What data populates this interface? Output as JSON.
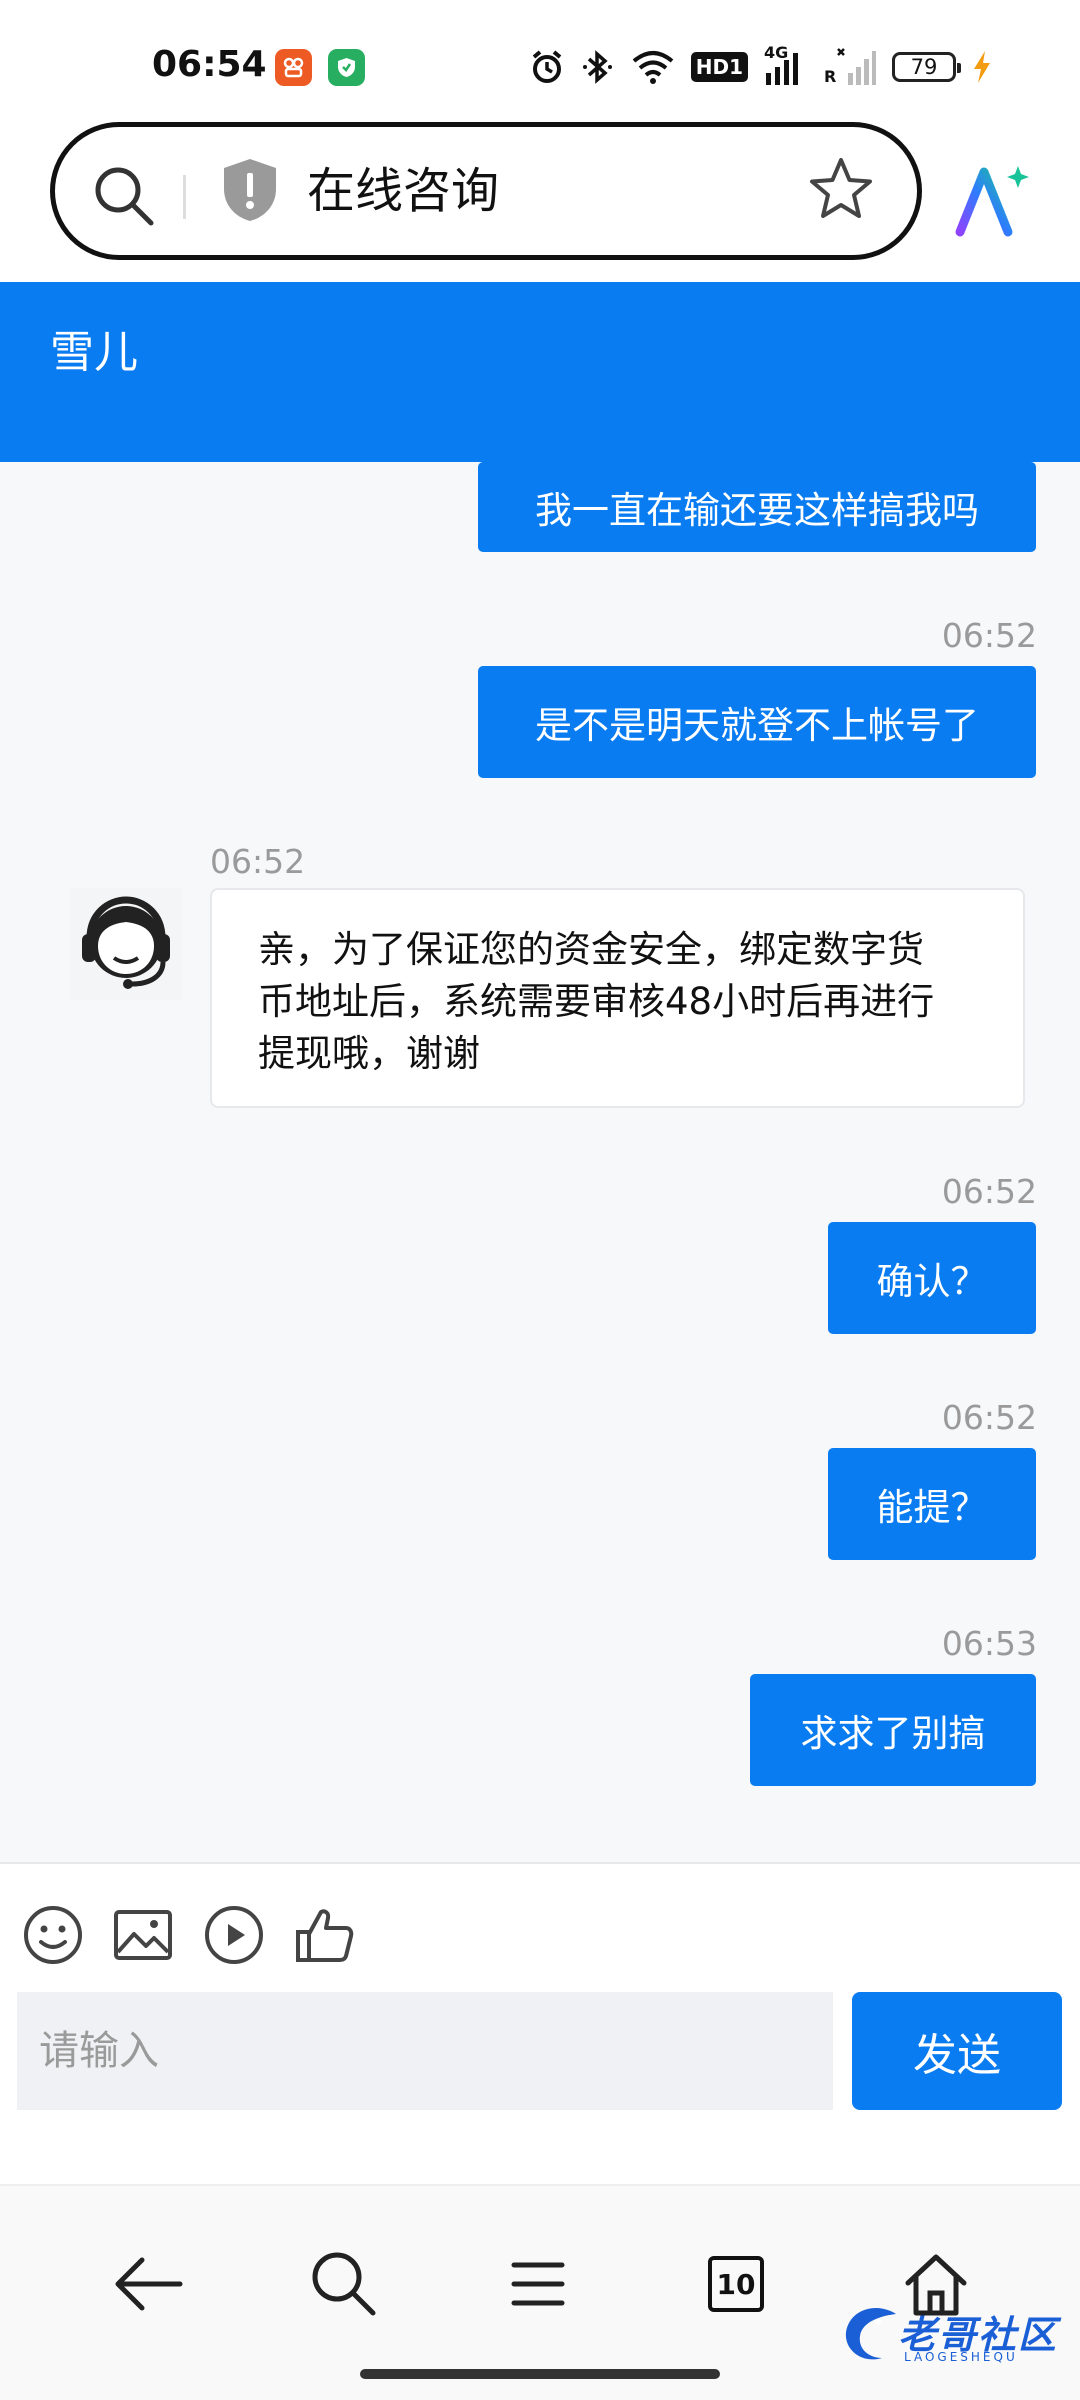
{
  "status_bar": {
    "time": "06:54",
    "hd_label": "HD1",
    "network_label": "4G",
    "roaming_label": "R",
    "battery": "79"
  },
  "address_bar": {
    "title": "在线咨询"
  },
  "chat": {
    "agent_name": "雪儿",
    "messages": [
      {
        "from": "me",
        "time": "",
        "text": "我一直在输还要这样搞我吗"
      },
      {
        "from": "me",
        "time": "06:52",
        "text": "是不是明天就登不上帐号了"
      },
      {
        "from": "agent",
        "time": "06:52",
        "lines": [
          "亲，为了保证您的资金安全，绑定数字货",
          "币地址后，系统需要审核48小时后再进行",
          "提现哦，谢谢"
        ]
      },
      {
        "from": "me",
        "time": "06:52",
        "text": "确认？"
      },
      {
        "from": "me",
        "time": "06:52",
        "text": "能提？"
      },
      {
        "from": "me",
        "time": "06:53",
        "text": "求求了别搞"
      }
    ]
  },
  "composer": {
    "placeholder": "请输入",
    "send_label": "发送",
    "tools": [
      "emoji-icon",
      "image-icon",
      "video-icon",
      "thumbs-up-icon"
    ]
  },
  "bottom_nav": {
    "tab_count": "10"
  },
  "watermark": {
    "text": "老哥社区",
    "sub": "LAOGESHEQU"
  },
  "colors": {
    "accent": "#0a7cf2",
    "timestamp": "#9a9a9a"
  }
}
